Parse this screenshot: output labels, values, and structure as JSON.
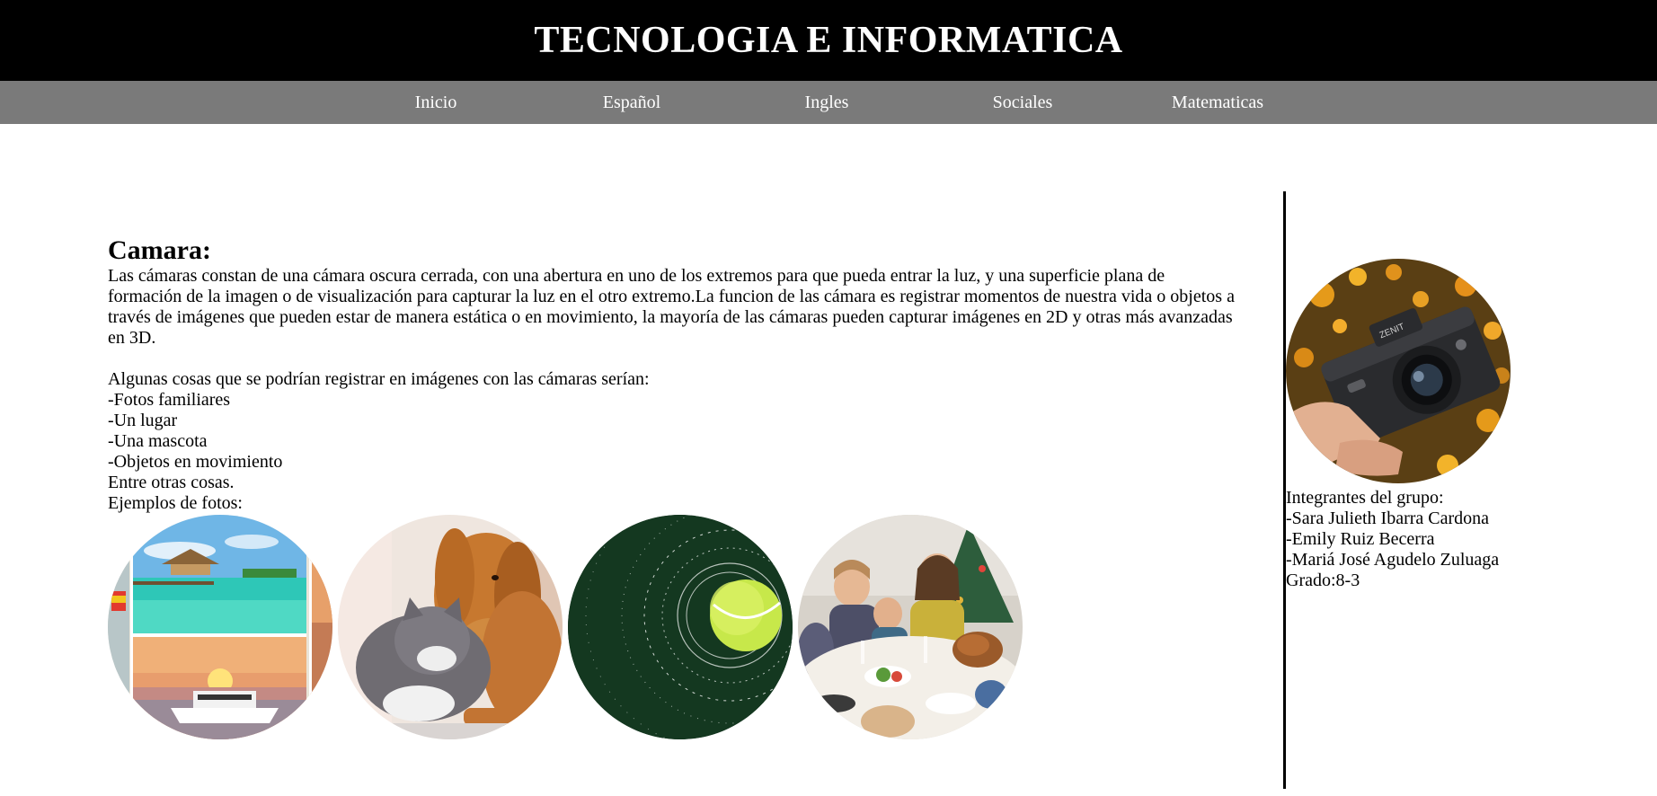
{
  "header": {
    "title": "TECNOLOGIA E INFORMATICA"
  },
  "nav": {
    "items": [
      {
        "label": "Inicio"
      },
      {
        "label": "Español"
      },
      {
        "label": "Ingles"
      },
      {
        "label": "Sociales"
      },
      {
        "label": "Matematicas"
      }
    ]
  },
  "article": {
    "heading": "Camara:",
    "paragraph": "Las cámaras constan de una cámara oscura cerrada, con una abertura en uno de los extremos para que pueda entrar la luz, y una superficie plana de formación de la imagen o de visualización para capturar la luz en el otro extremo.La funcion de las cámara es registrar momentos de nuestra vida o objetos a través de imágenes que pueden estar de manera estática o en movimiento, la mayoría de las cámaras pueden capturar imágenes en 2D y otras más avanzadas en 3D.",
    "list_intro": "Algunas cosas que se podrían registrar en imágenes con las cámaras serían:",
    "list_items": [
      "-Fotos familiares",
      "-Un lugar",
      "-Una mascota",
      "-Objetos en movimiento"
    ],
    "closing": "Entre otras cosas.",
    "examples_label": "Ejemplos de fotos:"
  },
  "photos": [
    {
      "icon": "beach-collage-photo"
    },
    {
      "icon": "dog-and-cat-photo"
    },
    {
      "icon": "tennis-ball-motion-photo"
    },
    {
      "icon": "family-dinner-photo"
    }
  ],
  "sidebar": {
    "icon": "camera-in-hand-photo",
    "group_label": "Integrantes del grupo:",
    "members": [
      "-Sara Julieth Ibarra Cardona",
      "-Emily Ruiz Becerra",
      "-Mariá José Agudelo Zuluaga"
    ],
    "grade": "Grado:8-3"
  },
  "colors": {
    "header_bg": "#000000",
    "nav_bg": "#7a7a7a",
    "nav_text": "#ffffff"
  }
}
